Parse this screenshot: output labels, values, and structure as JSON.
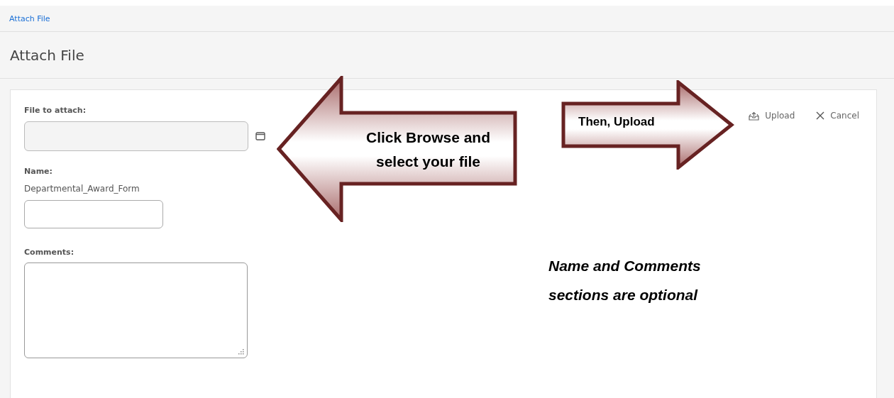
{
  "breadcrumb": "Attach File",
  "page_title": "Attach File",
  "form": {
    "file_label": "File to attach:",
    "name_label": "Name:",
    "name_text": "Departmental_Award_Form",
    "comments_label": "Comments:"
  },
  "actions": [
    {
      "kind": "upload",
      "label": "Upload"
    },
    {
      "kind": "cancel",
      "label": "Cancel"
    }
  ],
  "annotations": [
    {
      "kind": "arrow-left",
      "lines": [
        "Click Browse and",
        "select your file"
      ]
    },
    {
      "kind": "arrow-right",
      "lines": [
        "Then, Upload"
      ]
    },
    {
      "kind": "note",
      "lines": [
        "Name and Comments",
        "sections are optional"
      ]
    }
  ]
}
